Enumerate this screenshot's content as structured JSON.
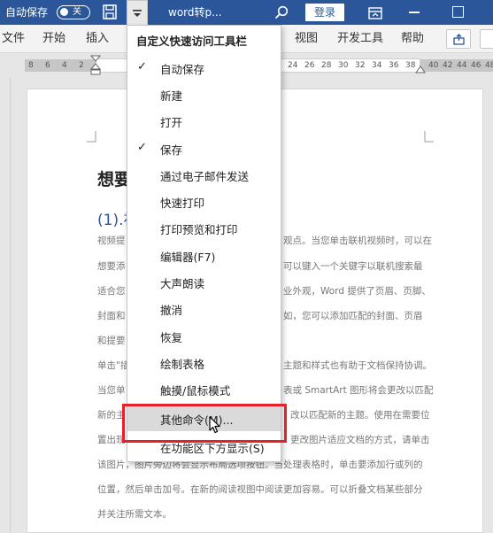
{
  "titlebar": {
    "autosave_label": "自动保存",
    "toggle_label": "关",
    "doc_title": "word转p...",
    "login_button": "登录"
  },
  "ribbon": {
    "tabs": [
      "文件",
      "开始",
      "插入",
      "视图",
      "开发工具",
      "帮助"
    ]
  },
  "ruler": {
    "left_numbers": [
      "8",
      "6",
      "4",
      "2"
    ],
    "right_numbers": [
      "24",
      "26",
      "28",
      "30",
      "32",
      "34",
      "36",
      "38",
      "40",
      "42",
      "44",
      "46",
      "48"
    ]
  },
  "menu": {
    "title": "自定义快速访问工具栏",
    "items": [
      {
        "label": "自动保存",
        "checked": true
      },
      {
        "label": "新建",
        "checked": false
      },
      {
        "label": "打开",
        "checked": false
      },
      {
        "label": "保存",
        "checked": true
      },
      {
        "label": "通过电子邮件发送",
        "checked": false
      },
      {
        "label": "快速打印",
        "checked": false
      },
      {
        "label": "打印预览和打印",
        "checked": false
      },
      {
        "label": "编辑器(F7)",
        "checked": false
      },
      {
        "label": "大声朗读",
        "checked": false
      },
      {
        "label": "撤消",
        "checked": false
      },
      {
        "label": "恢复",
        "checked": false
      },
      {
        "label": "绘制表格",
        "checked": false
      },
      {
        "label": "触摸/鼠标模式",
        "checked": false
      },
      {
        "label": "其他命令(M)...",
        "checked": false,
        "highlighted": true
      },
      {
        "label": "在功能区下方显示(S)",
        "checked": false
      }
    ]
  },
  "document": {
    "heading": "想要",
    "subheading": "(1).初",
    "lines": [
      {
        "left": "视频提",
        "right": "观点。当您单击联机视频时，可以在"
      },
      {
        "left": "想要添",
        "right": "可以键入一个关键字以联机搜索最"
      },
      {
        "left": "适合您",
        "right": "业外观，Word 提供了页眉、页脚、"
      },
      {
        "left": "封面和",
        "right": "如，您可以添加匹配的封面、页眉"
      },
      {
        "left": "和提要",
        "right": ""
      },
      {
        "left": "单击\"插",
        "right": "主题和样式也有助于文档保持协调。"
      },
      {
        "left": "当您单",
        "right": "表或 SmartArt 图形将会更改以匹配"
      },
      {
        "left": "新的主",
        "right": "改以匹配新的主题。使用在需要位"
      },
      {
        "left": "置出现",
        "right": "更改图片适应文档的方式，请单击"
      },
      {
        "left": "该图片，图片旁边将会显示布局选项按钮。当处理表格时，单击要添加行或列的",
        "right": ""
      },
      {
        "left": "位置，然后单击加号。在新的阅读视图中阅读更加容易。可以折叠文档某些部分",
        "right": ""
      },
      {
        "left": "并关注所需文本。",
        "right": ""
      }
    ]
  }
}
